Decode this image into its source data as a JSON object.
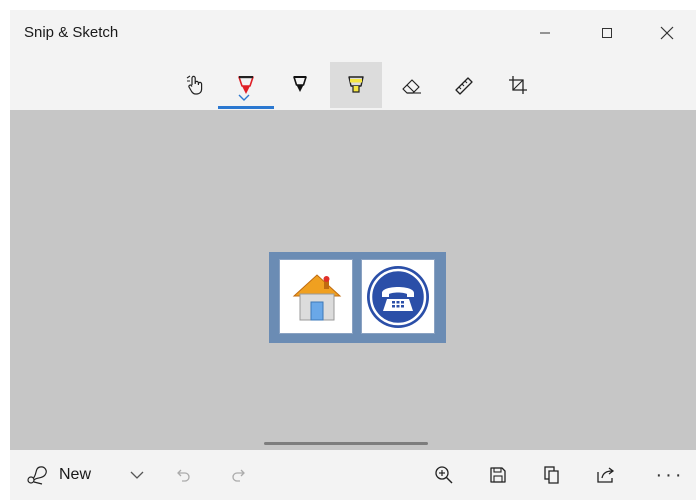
{
  "window": {
    "title": "Snip & Sketch"
  },
  "toolbar": {
    "tools": [
      {
        "name": "touch-writing",
        "icon": "touch-writing-icon"
      },
      {
        "name": "ballpoint-pen",
        "icon": "ballpoint-pen-icon",
        "color": "#e01f26",
        "selected": true
      },
      {
        "name": "pencil",
        "icon": "pencil-icon",
        "color": "#111111"
      },
      {
        "name": "highlighter",
        "icon": "highlighter-icon",
        "color": "#f5e642",
        "active": true
      },
      {
        "name": "eraser",
        "icon": "eraser-icon"
      },
      {
        "name": "ruler",
        "icon": "ruler-icon"
      },
      {
        "name": "crop",
        "icon": "crop-icon"
      }
    ],
    "accent_color": "#2b78d0"
  },
  "canvas": {
    "background": "#c6c6c6",
    "snip": {
      "frame_color": "#6b8cb4",
      "images": [
        "home-icon",
        "telephone-icon"
      ]
    }
  },
  "bottombar": {
    "new_label": "New",
    "more_label": "···",
    "commands": [
      "new-snip-icon",
      "chevron-down-icon",
      "undo-icon",
      "redo-icon",
      "zoom-icon",
      "save-icon",
      "copy-icon",
      "share-icon",
      "more-icon"
    ]
  }
}
